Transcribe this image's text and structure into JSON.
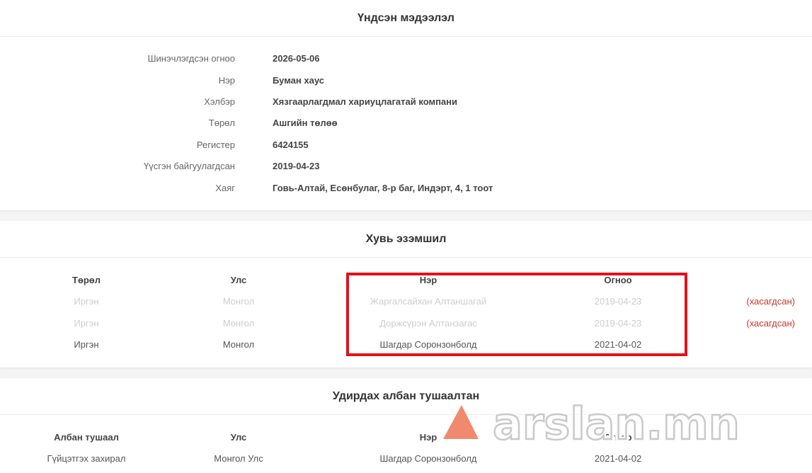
{
  "basic": {
    "title": "Үндсэн мэдээлэл",
    "rows": [
      {
        "label": "Шинэчлэгдсэн огноо",
        "value": "2026-05-06"
      },
      {
        "label": "Нэр",
        "value": "Буман хаус"
      },
      {
        "label": "Хэлбэр",
        "value": "Хязгаарлагдмал хариуцлагатай компани"
      },
      {
        "label": "Төрөл",
        "value": "Ашгийн төлөө"
      },
      {
        "label": "Регистер",
        "value": "6424155"
      },
      {
        "label": "Үүсгэн байгуулагдсан",
        "value": "2019-04-23"
      },
      {
        "label": "Хаяг",
        "value": "Говь-Алтай, Есөнбулаг, 8-р баг, Индэрт, 4, 1 тоот"
      }
    ]
  },
  "owners": {
    "title": "Хувь эзэмшил",
    "headers": [
      "Төрөл",
      "Улс",
      "Нэр",
      "Огноо"
    ],
    "rows": [
      {
        "type": "Иргэн",
        "country": "Монгол",
        "name": "Жаргалсайхан Алтаншагай",
        "date": "2019-04-23",
        "status": "(хасагдсан)"
      },
      {
        "type": "Иргэн",
        "country": "Монгол",
        "name": "Доржсүрэн Алтанзагас",
        "date": "2019-04-23",
        "status": "(хасагдсан)"
      },
      {
        "type": "Иргэн",
        "country": "Монгол",
        "name": "Шагдар Соронзонболд",
        "date": "2021-04-02",
        "status": ""
      }
    ]
  },
  "officials": {
    "title": "Удирдах албан тушаалтан",
    "headers": [
      "Албан тушаал",
      "Улс",
      "Нэр",
      "Огноо"
    ],
    "rows": [
      {
        "position": "Гүйцэтгэх захирал",
        "country": "Монгол Улс",
        "name": "Шагдар Соронзонболд",
        "date": "2021-04-02"
      }
    ]
  },
  "watermark": {
    "text": "arslan.mn",
    "color": "#f08a6f"
  },
  "colors": {
    "highlight": "#e3111b",
    "removed": "#c0392b"
  }
}
